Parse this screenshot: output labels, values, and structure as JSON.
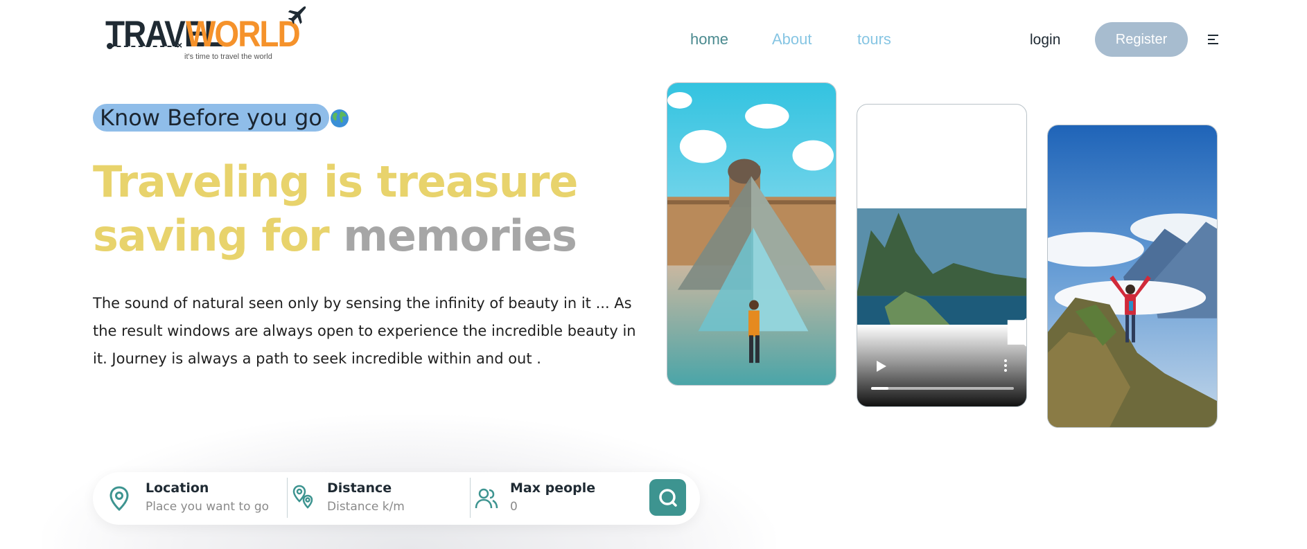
{
  "header": {
    "logo": {
      "brand_part1": "TRAVEL",
      "brand_part2": "WORLD",
      "tagline": "it's time to travel the world"
    },
    "nav": [
      {
        "label": "home",
        "color": "#4a8a8f"
      },
      {
        "label": "About",
        "color": "#86c5e3"
      },
      {
        "label": "tours",
        "color": "#86c5e3"
      }
    ],
    "login_label": "login",
    "register_label": "Register",
    "menu_icon": "menu-icon"
  },
  "hero": {
    "badge": "Know Before you go",
    "badge_icon": "globe-icon",
    "headline_highlight": "Traveling is treasure saving for",
    "headline_muted": "memories",
    "description": "The sound of natural seen only by sensing the infinity of beauty in it ... As the result windows are always open to experience the incredible beauty in it. Journey is always a path to seek incredible within and out ."
  },
  "media": {
    "video_progress": 0.12
  },
  "search": {
    "location": {
      "label": "Location",
      "placeholder": "Place you want to go",
      "icon": "map-pin-icon"
    },
    "distance": {
      "label": "Distance",
      "placeholder": "Distance k/m",
      "icon": "route-icon"
    },
    "max_people": {
      "label": "Max people",
      "placeholder": "0",
      "icon": "people-icon"
    },
    "button_icon": "search-icon"
  },
  "colors": {
    "accent_yellow": "#e8d36c",
    "muted_grey": "#a6a6a6",
    "teal": "#3d9490",
    "badge_blue": "#8fbde9",
    "register_bg": "#a7bccf",
    "logo_orange": "#f5922b"
  }
}
